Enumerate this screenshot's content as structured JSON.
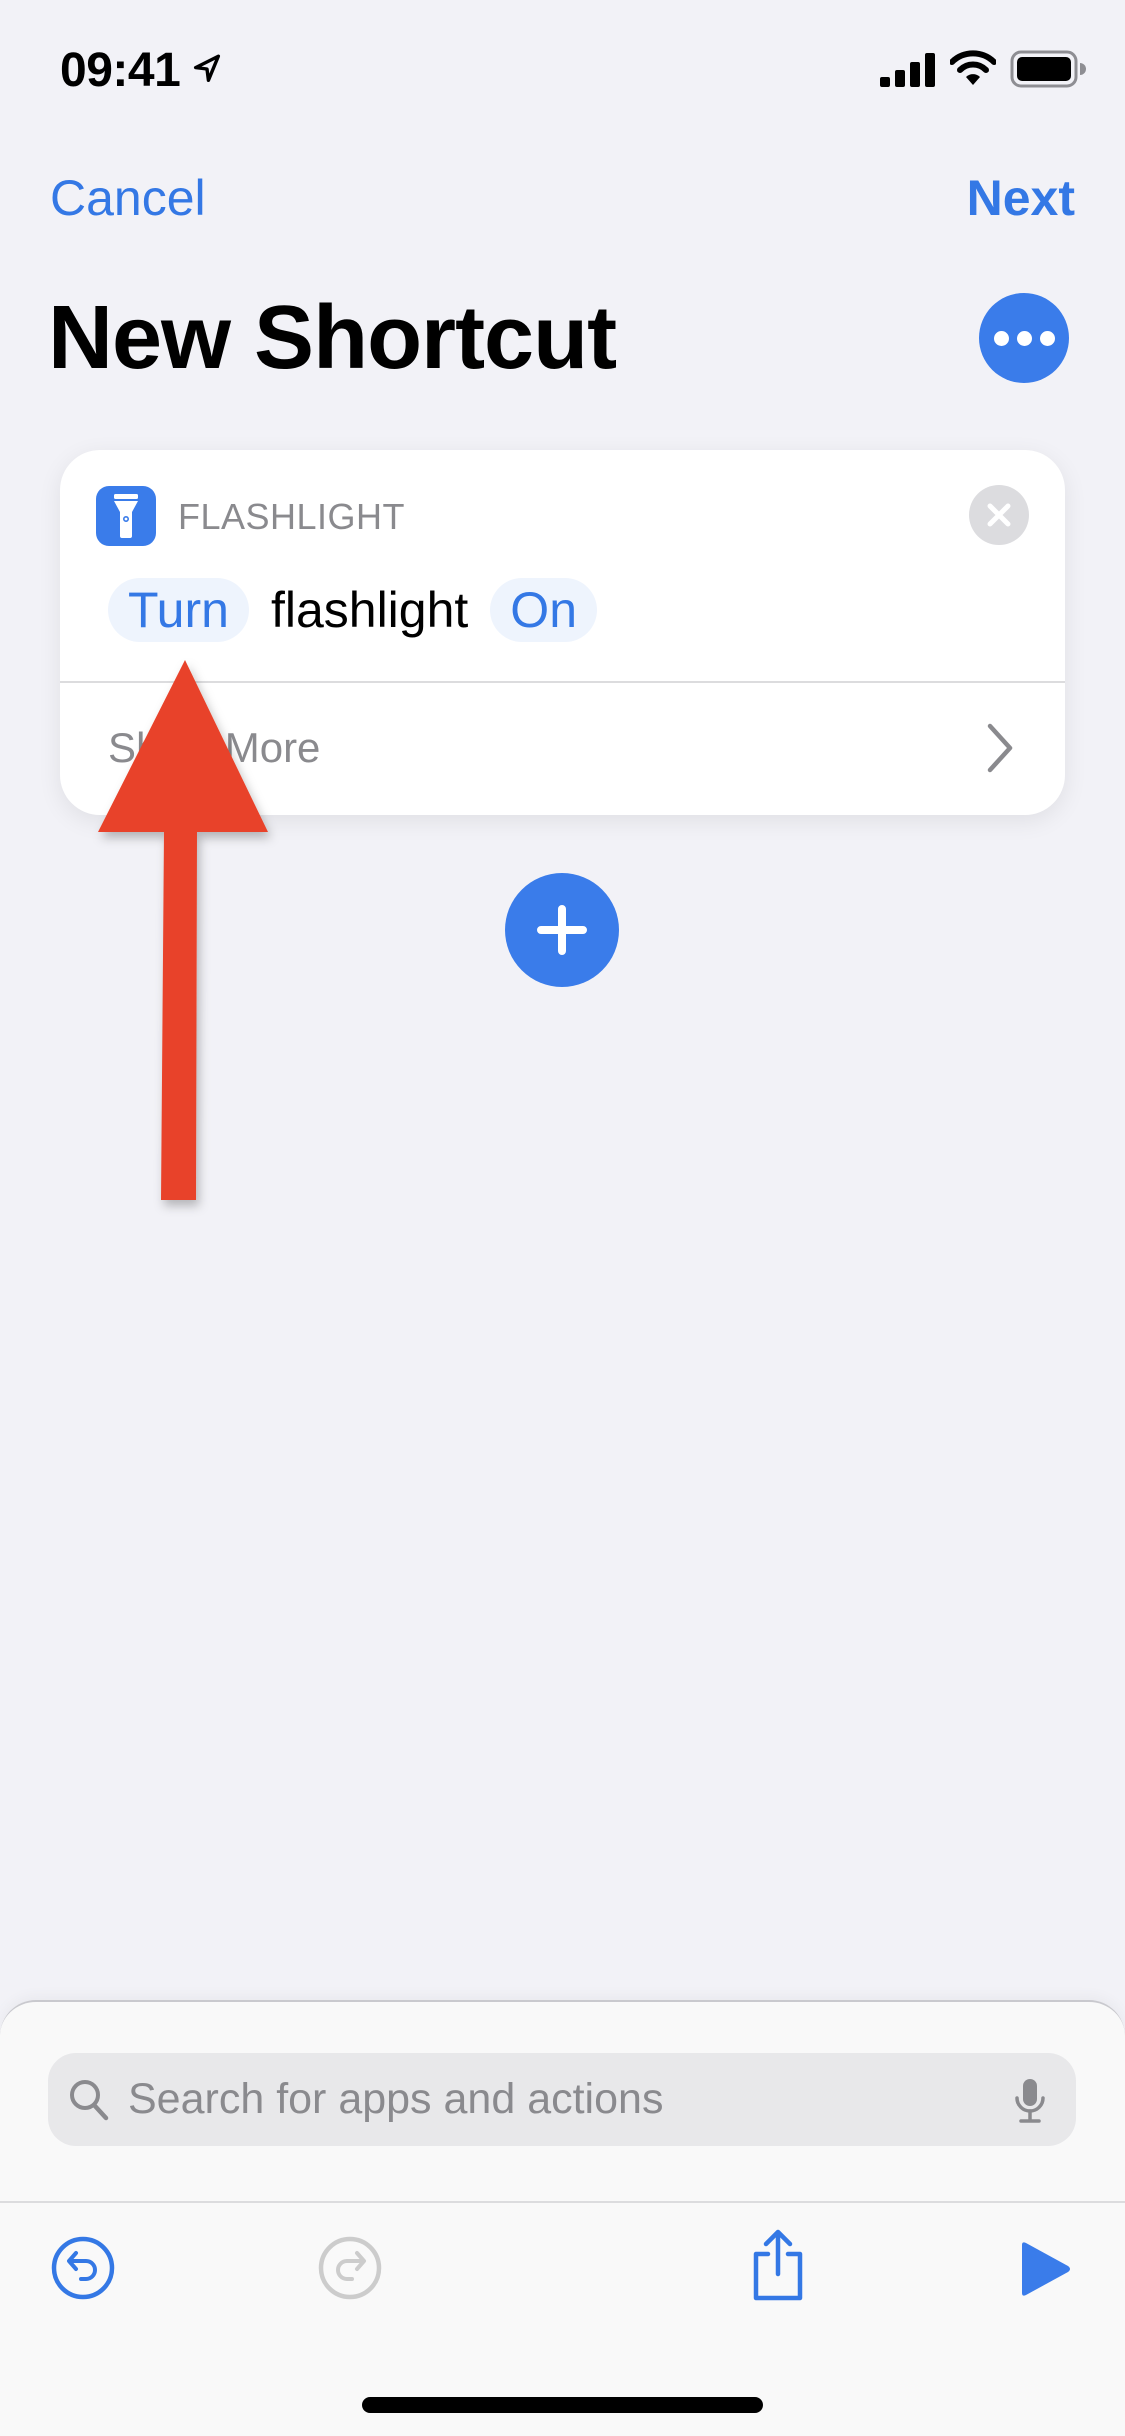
{
  "status_bar": {
    "time": "09:41",
    "icons": [
      "location-arrow-icon",
      "cellular-signal-icon",
      "wifi-icon",
      "battery-icon"
    ]
  },
  "nav": {
    "cancel_label": "Cancel",
    "next_label": "Next"
  },
  "header": {
    "title": "New Shortcut",
    "more_icon": "ellipsis-icon"
  },
  "action_card": {
    "app_icon": "flashlight-icon",
    "app_name": "FLASHLIGHT",
    "close_icon": "close-icon",
    "parameter_row": {
      "verb_param": "Turn",
      "object_text": "flashlight",
      "state_param": "On"
    },
    "show_more_label": "Show More",
    "show_more_icon": "chevron-right-icon"
  },
  "add_action_icon": "plus-icon",
  "annotation": {
    "type": "arrow",
    "color": "#e8432a",
    "points_to": "Turn"
  },
  "bottom_sheet": {
    "search": {
      "placeholder": "Search for apps and actions",
      "value": ""
    },
    "toolbar": {
      "undo": {
        "icon": "undo-icon",
        "enabled": true
      },
      "redo": {
        "icon": "redo-icon",
        "enabled": false
      },
      "share": {
        "icon": "share-icon"
      },
      "run": {
        "icon": "play-icon"
      }
    }
  },
  "colors": {
    "accent": "#3a7cea",
    "background": "#f2f2f7",
    "secondary_text": "#8a8a8e",
    "disabled": "#cccccc",
    "annotation": "#e8432a"
  }
}
